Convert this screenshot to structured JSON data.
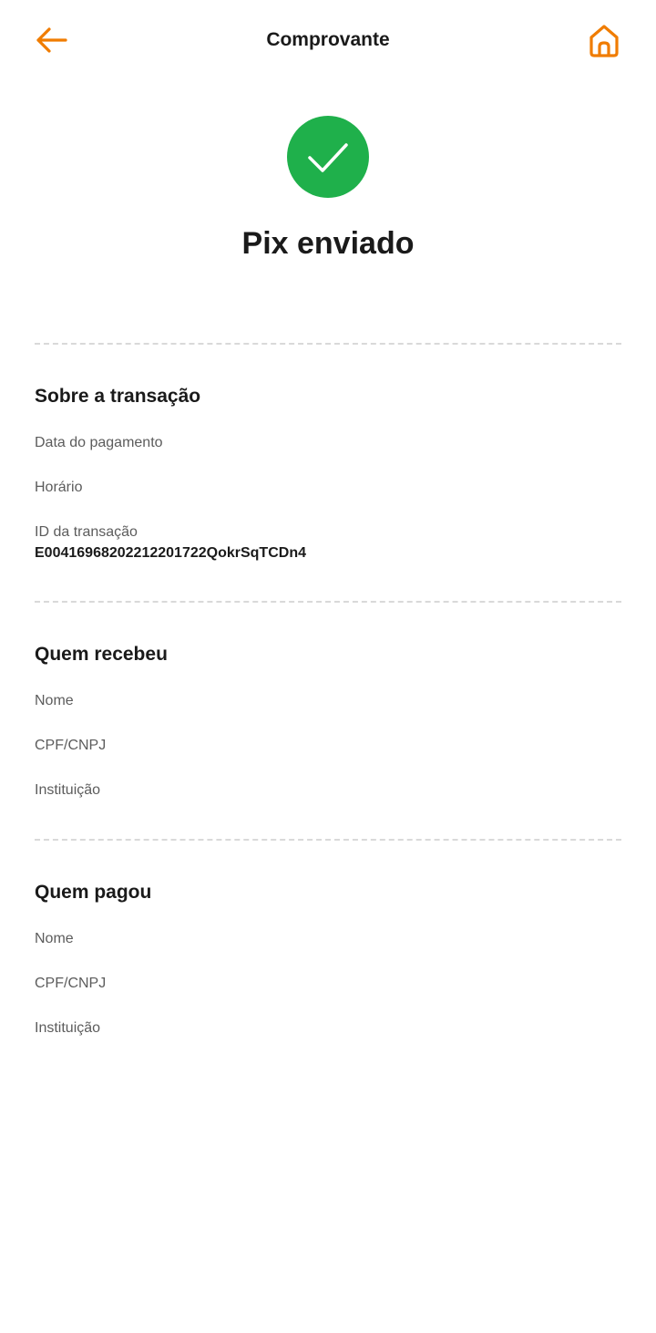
{
  "header": {
    "title": "Comprovante",
    "back_icon": "arrow-left-icon",
    "home_icon": "home-icon",
    "accent_color": "#F07C00"
  },
  "status": {
    "icon": "check-icon",
    "icon_color": "#1FB04B",
    "headline": "Pix enviado"
  },
  "transaction": {
    "title": "Sobre a transação",
    "date_label": "Data do pagamento",
    "time_label": "Horário",
    "id_label": "ID da transação",
    "id_value": "E00416968202212201722QokrSqTCDn4"
  },
  "receiver": {
    "title": "Quem recebeu",
    "name_label": "Nome",
    "doc_label": "CPF/CNPJ",
    "institution_label": "Instituição"
  },
  "payer": {
    "title": "Quem pagou",
    "name_label": "Nome",
    "doc_label": "CPF/CNPJ",
    "institution_label": "Instituição"
  }
}
